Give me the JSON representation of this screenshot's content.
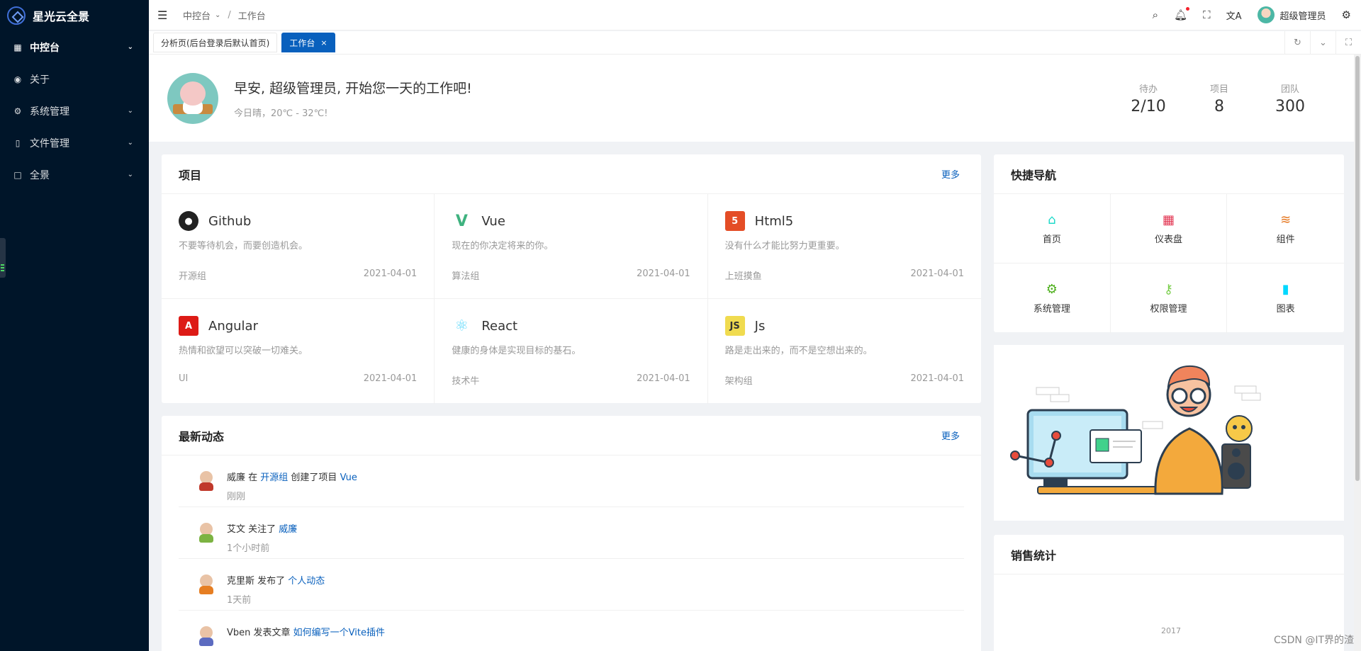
{
  "app": {
    "title": "星光云全景"
  },
  "sidebar": {
    "items": [
      {
        "label": "中控台",
        "icon": "dashboard-icon",
        "has_children": true,
        "active": true
      },
      {
        "label": "关于",
        "icon": "eye-icon",
        "has_children": false
      },
      {
        "label": "系统管理",
        "icon": "gear-icon",
        "has_children": true
      },
      {
        "label": "文件管理",
        "icon": "file-icon",
        "has_children": true
      },
      {
        "label": "全景",
        "icon": "square-icon",
        "has_children": true
      }
    ]
  },
  "header": {
    "breadcrumb": [
      "中控台",
      "工作台"
    ],
    "user_name": "超级管理员"
  },
  "tabs": [
    {
      "label": "分析页(后台登录后默认首页)",
      "active": false
    },
    {
      "label": "工作台",
      "active": true
    }
  ],
  "welcome": {
    "greeting": "早安, 超级管理员, 开始您一天的工作吧!",
    "weather": "今日晴，20℃ - 32℃!",
    "stats": [
      {
        "label": "待办",
        "value": "2/10"
      },
      {
        "label": "项目",
        "value": "8"
      },
      {
        "label": "团队",
        "value": "300"
      }
    ]
  },
  "projects": {
    "title": "项目",
    "more": "更多",
    "items": [
      {
        "name": "Github",
        "desc": "不要等待机会，而要创造机会。",
        "group": "开源组",
        "date": "2021-04-01",
        "icon": "github-icon",
        "color": "#222222"
      },
      {
        "name": "Vue",
        "desc": "现在的你决定将来的你。",
        "group": "算法组",
        "date": "2021-04-01",
        "icon": "vue-icon",
        "color": "#3fb27f"
      },
      {
        "name": "Html5",
        "desc": "没有什么才能比努力更重要。",
        "group": "上班摸鱼",
        "date": "2021-04-01",
        "icon": "html5-icon",
        "color": "#e44d26"
      },
      {
        "name": "Angular",
        "desc": "热情和欲望可以突破一切难关。",
        "group": "UI",
        "date": "2021-04-01",
        "icon": "angular-icon",
        "color": "#dd1b16"
      },
      {
        "name": "React",
        "desc": "健康的身体是实现目标的基石。",
        "group": "技术牛",
        "date": "2021-04-01",
        "icon": "react-icon",
        "color": "#61dafb"
      },
      {
        "name": "Js",
        "desc": "路是走出来的，而不是空想出来的。",
        "group": "架构组",
        "date": "2021-04-01",
        "icon": "js-icon",
        "color": "#f0db4f"
      }
    ]
  },
  "activity": {
    "title": "最新动态",
    "more": "更多",
    "items": [
      {
        "user": "威廉",
        "action": " 在 ",
        "link1": "开源组",
        "action2": " 创建了项目 ",
        "link2": "Vue",
        "time": "刚刚",
        "color": "#c0392b"
      },
      {
        "user": "艾文",
        "action": " 关注了 ",
        "link1": "威廉",
        "action2": "",
        "link2": "",
        "time": "1个小时前",
        "color": "#7cb342"
      },
      {
        "user": "克里斯",
        "action": " 发布了 ",
        "link1": "个人动态",
        "action2": "",
        "link2": "",
        "time": "1天前",
        "color": "#e67e22"
      },
      {
        "user": "Vben",
        "action": " 发表文章 ",
        "link1": "如何编写一个Vite插件",
        "action2": "",
        "link2": "",
        "time": "",
        "color": "#5c6bc0"
      }
    ]
  },
  "quick_nav": {
    "title": "快捷导航",
    "items": [
      {
        "label": "首页",
        "icon": "home-icon",
        "color": "#1fdaca"
      },
      {
        "label": "仪表盘",
        "icon": "dashboard-icon",
        "color": "#e2324f"
      },
      {
        "label": "组件",
        "icon": "layers-icon",
        "color": "#e5771f"
      },
      {
        "label": "系统管理",
        "icon": "gear-icon",
        "color": "#4daf1b"
      },
      {
        "label": "权限管理",
        "icon": "key-icon",
        "color": "#7ace4c"
      },
      {
        "label": "图表",
        "icon": "bar-chart-icon",
        "color": "#00d8ff"
      }
    ]
  },
  "sales": {
    "title": "销售统计",
    "axis_label": "2017"
  },
  "watermark": "CSDN @IT界的渣"
}
